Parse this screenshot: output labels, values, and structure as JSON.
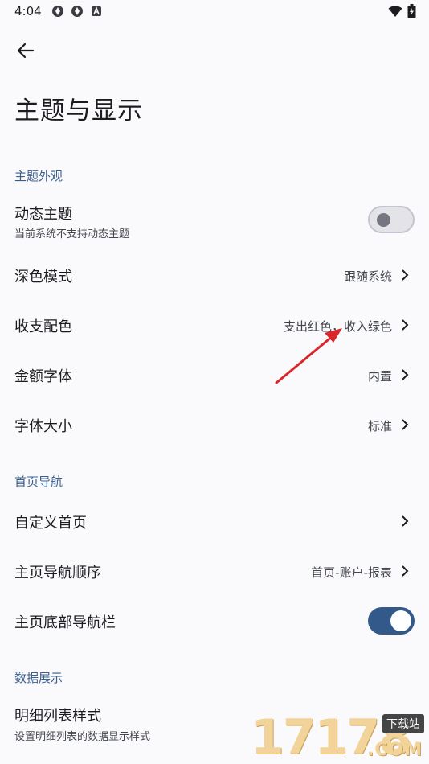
{
  "status_bar": {
    "time": "4:04",
    "left_icons": [
      "aperture-icon",
      "aperture-icon",
      "a-badge-icon"
    ],
    "right_icons": [
      "wifi-icon",
      "battery-charging-icon"
    ]
  },
  "header": {
    "title": "主题与显示"
  },
  "sections": {
    "appearance": {
      "header": "主题外观",
      "dynamic_theme": {
        "title": "动态主题",
        "subtitle": "当前系统不支持动态主题",
        "enabled": false
      },
      "dark_mode": {
        "title": "深色模式",
        "value": "跟随系统"
      },
      "income_color": {
        "title": "收支配色",
        "value": "支出红色，收入绿色"
      },
      "amount_font": {
        "title": "金额字体",
        "value": "内置"
      },
      "font_size": {
        "title": "字体大小",
        "value": "标准"
      }
    },
    "home_nav": {
      "header": "首页导航",
      "custom_home": {
        "title": "自定义首页",
        "value": ""
      },
      "nav_order": {
        "title": "主页导航顺序",
        "value": "首页-账户-报表"
      },
      "bottom_nav": {
        "title": "主页底部导航栏",
        "enabled": true
      }
    },
    "data_display": {
      "header": "数据展示",
      "detail_list": {
        "title": "明细列表样式",
        "subtitle": "设置明细列表的数据显示样式"
      }
    }
  },
  "watermark": {
    "digits": "17178",
    "tag": "下载站",
    "domain": ".COM"
  },
  "colors": {
    "accent": "#33598a",
    "section_header": "#3a5f8f",
    "annotation_arrow": "#d9262a"
  }
}
